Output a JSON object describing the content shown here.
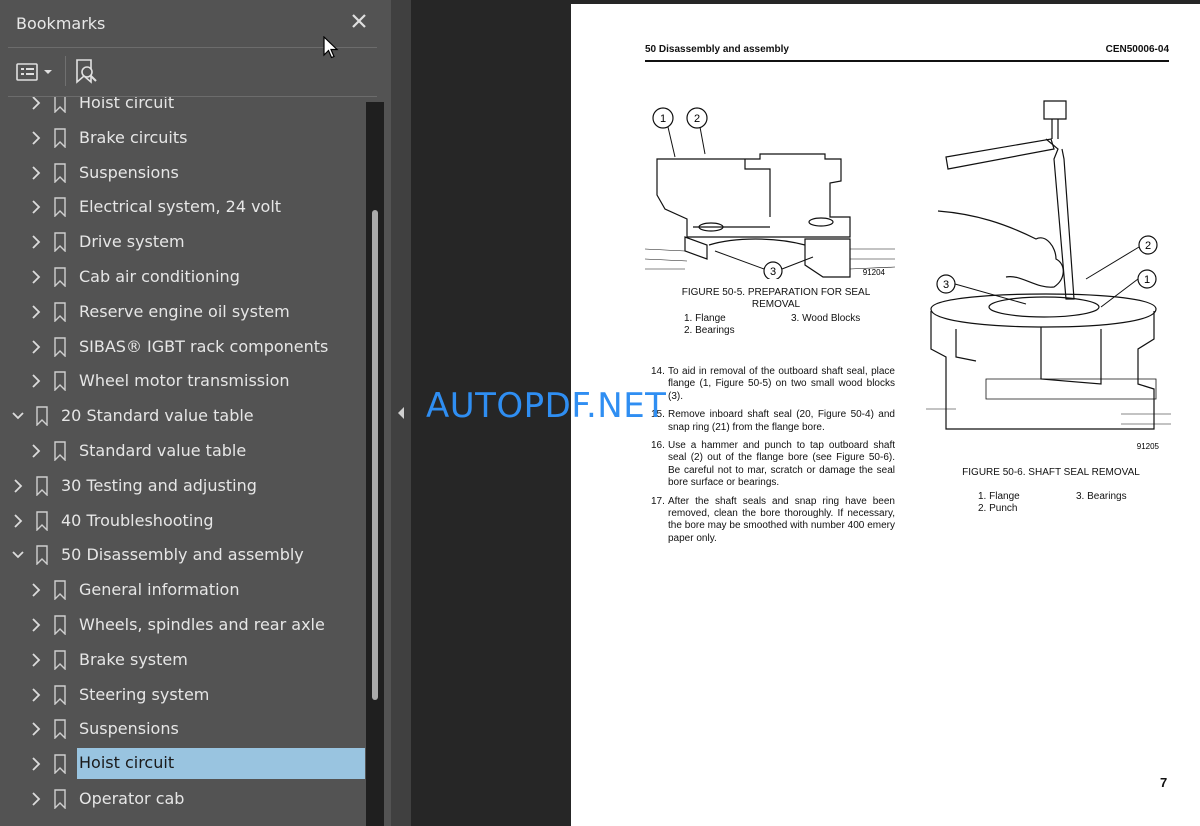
{
  "sidebar": {
    "title": "Bookmarks",
    "items": [
      {
        "label": "Hoist circuit",
        "level": 2,
        "expanded": false,
        "selected": false
      },
      {
        "label": "Brake circuits",
        "level": 2,
        "expanded": false,
        "selected": false
      },
      {
        "label": "Suspensions",
        "level": 2,
        "expanded": false,
        "selected": false
      },
      {
        "label": "Electrical system, 24 volt",
        "level": 2,
        "expanded": false,
        "selected": false
      },
      {
        "label": "Drive system",
        "level": 2,
        "expanded": false,
        "selected": false
      },
      {
        "label": "Cab air conditioning",
        "level": 2,
        "expanded": false,
        "selected": false
      },
      {
        "label": "Reserve engine oil system",
        "level": 2,
        "expanded": false,
        "selected": false
      },
      {
        "label": "SIBAS® IGBT rack components",
        "level": 2,
        "expanded": false,
        "selected": false
      },
      {
        "label": "Wheel motor transmission",
        "level": 2,
        "expanded": false,
        "selected": false
      },
      {
        "label": "20 Standard value table",
        "level": 1,
        "expanded": true,
        "selected": false
      },
      {
        "label": "Standard value table",
        "level": 2,
        "expanded": false,
        "selected": false
      },
      {
        "label": "30 Testing and adjusting",
        "level": 1,
        "expanded": false,
        "selected": false
      },
      {
        "label": "40 Troubleshooting",
        "level": 1,
        "expanded": false,
        "selected": false
      },
      {
        "label": "50 Disassembly and assembly",
        "level": 1,
        "expanded": true,
        "selected": false
      },
      {
        "label": "General information",
        "level": 2,
        "expanded": false,
        "selected": false
      },
      {
        "label": "Wheels, spindles and rear axle",
        "level": 2,
        "expanded": false,
        "selected": false
      },
      {
        "label": "Brake system",
        "level": 2,
        "expanded": false,
        "selected": false
      },
      {
        "label": "Steering system",
        "level": 2,
        "expanded": false,
        "selected": false
      },
      {
        "label": "Suspensions",
        "level": 2,
        "expanded": false,
        "selected": false
      },
      {
        "label": "Hoist circuit",
        "level": 2,
        "expanded": false,
        "selected": true
      },
      {
        "label": "Operator cab",
        "level": 2,
        "expanded": false,
        "selected": false
      }
    ]
  },
  "page": {
    "header_left": "50 Disassembly and assembly",
    "header_right": "CEN50006-04",
    "fig1": {
      "callouts": [
        "1",
        "2",
        "3"
      ],
      "code": "91204",
      "caption_line1": "FIGURE 50-5. PREPARATION FOR SEAL",
      "caption_line2": "REMOVAL",
      "legend_1": "1. Flange",
      "legend_2": "2. Bearings",
      "legend_3": "3. Wood Blocks"
    },
    "fig2": {
      "callouts": [
        "1",
        "2",
        "3"
      ],
      "code": "91205",
      "caption": "FIGURE 50-6. SHAFT SEAL REMOVAL",
      "legend_1": "1. Flange",
      "legend_2": "2. Punch",
      "legend_3": "3. Bearings"
    },
    "steps": [
      {
        "num": "14.",
        "text": "To aid in removal of the outboard shaft seal, place flange (1, Figure 50-5) on two small wood blocks (3)."
      },
      {
        "num": "15.",
        "text": "Remove inboard shaft seal (20, Figure 50-4) and snap ring (21) from the flange bore."
      },
      {
        "num": "16.",
        "text": "Use a hammer and punch to tap outboard shaft seal (2) out of the flange bore (see Figure 50-6). Be careful not to mar, scratch or damage the seal bore surface or bearings."
      },
      {
        "num": "17.",
        "text": "After the shaft seals and snap ring have been removed, clean the bore thoroughly. If necessary, the bore may be smoothed with number 400 emery paper only."
      }
    ],
    "page_number": "7"
  },
  "watermark": "AUTOPDF.NET",
  "colors": {
    "sidebar_bg": "#535353",
    "selection": "#99c4e0",
    "watermark": "#2f8ef2"
  }
}
